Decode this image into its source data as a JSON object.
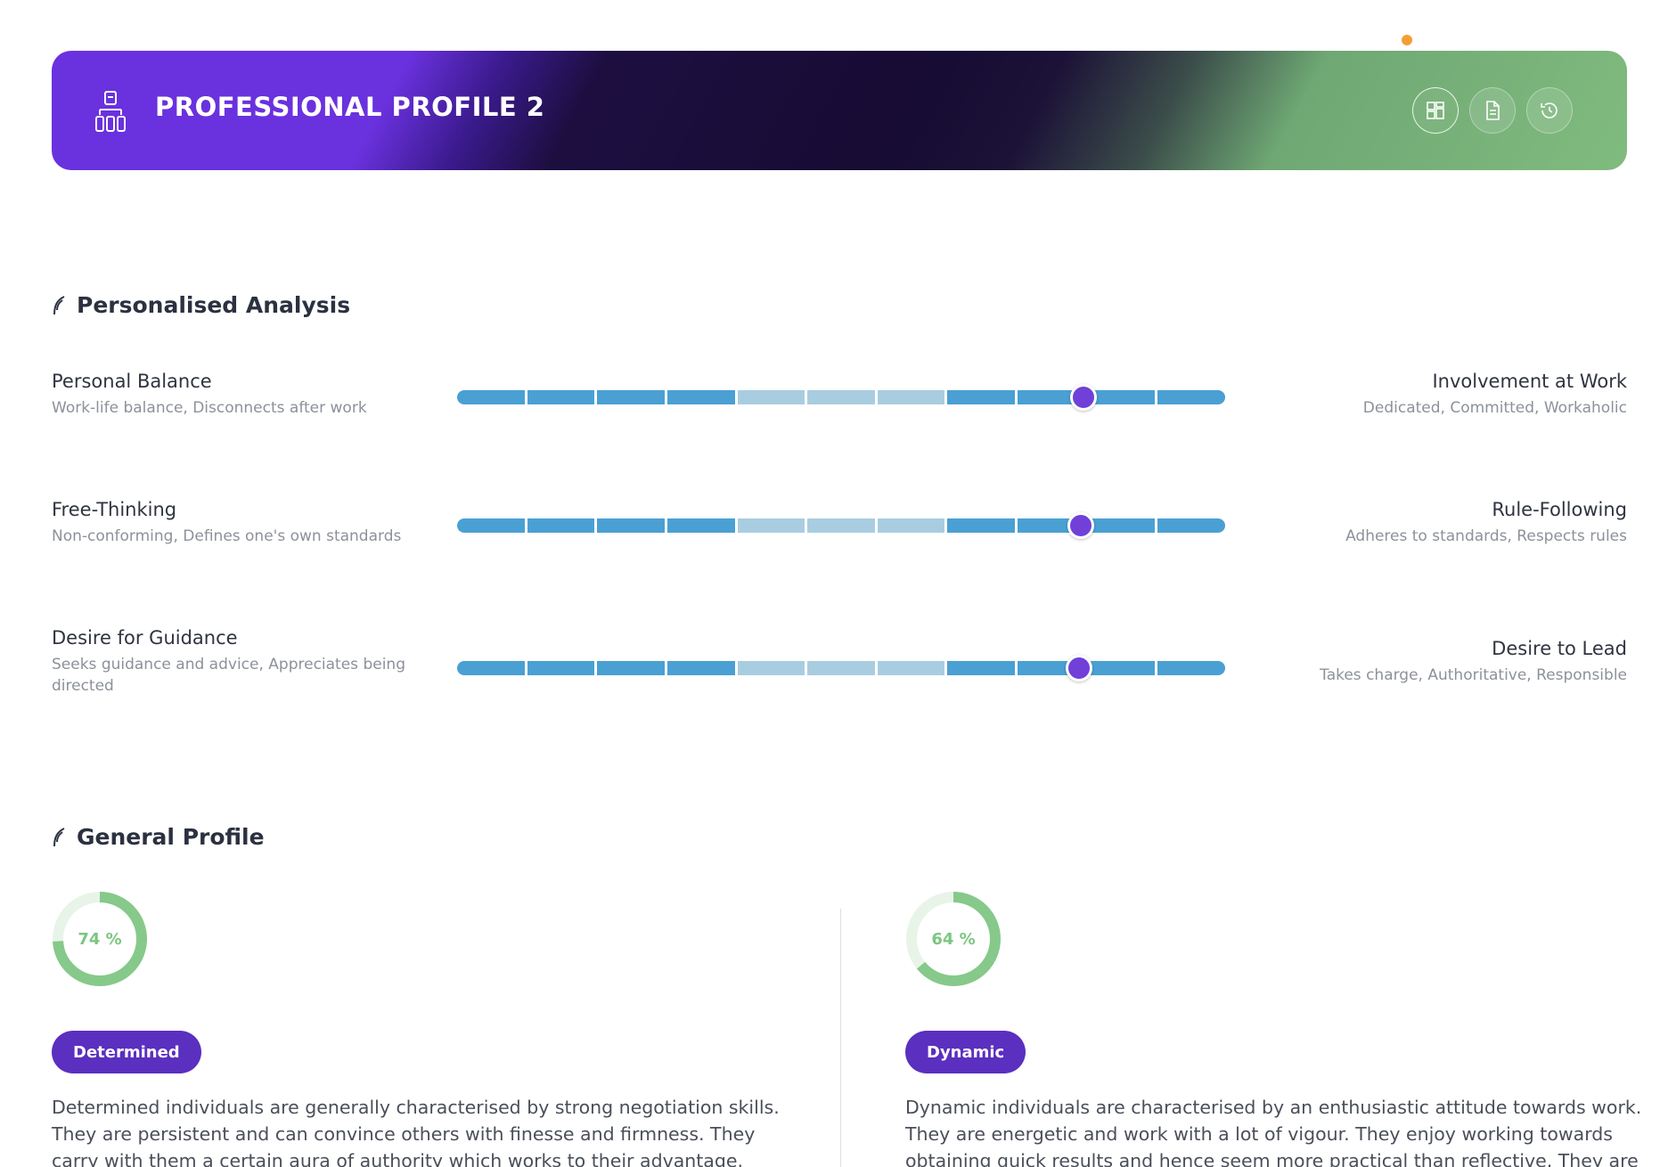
{
  "header": {
    "title": "PROFESSIONAL PROFILE 2",
    "logo_icon": "profile-logo-icon",
    "actions": [
      {
        "name": "dashboard-icon",
        "active": true
      },
      {
        "name": "document-icon",
        "active": false
      },
      {
        "name": "history-icon",
        "active": false
      }
    ],
    "notification_color": "#f2a033"
  },
  "personalised_analysis": {
    "title": "Personalised Analysis",
    "scales": [
      {
        "left_title": "Personal Balance",
        "left_desc": "Work-life balance, Disconnects after work",
        "right_title": "Involvement at Work",
        "right_desc": "Dedicated, Committed, Workaholic",
        "position": 0.815
      },
      {
        "left_title": "Free-Thinking",
        "left_desc": "Non-conforming, Defines one's own standards",
        "right_title": "Rule-Following",
        "right_desc": "Adheres to standards, Respects rules",
        "position": 0.812
      },
      {
        "left_title": "Desire for Guidance",
        "left_desc": "Seeks guidance and advice, Appreciates being directed",
        "right_title": "Desire to Lead",
        "right_desc": "Takes charge, Authoritative, Responsible",
        "position": 0.81
      }
    ],
    "segment_shades": [
      "dark",
      "dark",
      "dark",
      "dark",
      "light",
      "light",
      "light",
      "dark",
      "dark",
      "dark",
      "dark"
    ]
  },
  "general_profile": {
    "title": "General Profile",
    "traits": [
      {
        "percent_label": "74 %",
        "percent": 74,
        "tag": "Determined",
        "text": "Determined individuals are generally characterised by strong negotiation skills. They are persistent and can convince others with finesse and firmness. They carry with them a certain aura of authority which works to their advantage."
      },
      {
        "percent_label": "64 %",
        "percent": 64,
        "tag": "Dynamic",
        "text": "Dynamic individuals are characterised by an enthusiastic attitude towards work. They are energetic and work with a lot of vigour. They enjoy working towards obtaining quick results and hence seem more practical than reflective. They are"
      }
    ]
  },
  "colors": {
    "scale_dark": "#4aa0d3",
    "scale_light": "#a9cde0",
    "knob": "#7040d9",
    "gauge": "#86c98a",
    "tag": "#5b2fbf"
  }
}
